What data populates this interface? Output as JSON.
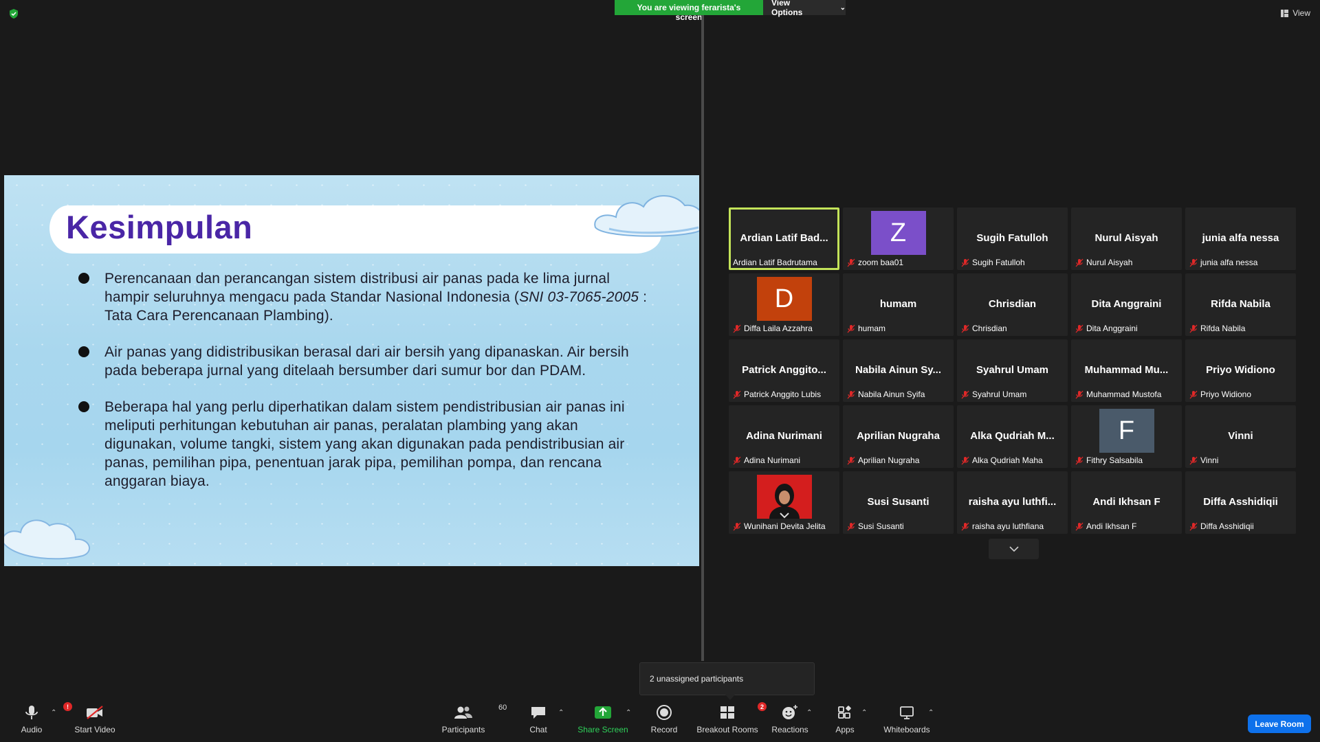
{
  "banner": {
    "viewing_text": "You are viewing ferarista's screen",
    "view_options_label": "View Options",
    "view_label": "View"
  },
  "slide": {
    "title": "Kesimpulan",
    "bullets": [
      {
        "pre": "Perencanaan dan perancangan sistem distribusi air panas pada ke lima jurnal hampir seluruhnya mengacu pada Standar Nasional Indonesia (",
        "italic": "SNI 03-7065-2005",
        "post": " : Tata Cara Perencanaan Plambing)."
      },
      {
        "pre": "Air panas yang didistribusikan berasal dari air bersih yang dipanaskan. Air bersih pada beberapa jurnal yang ditelaah bersumber dari sumur bor dan PDAM.",
        "italic": "",
        "post": ""
      },
      {
        "pre": "Beberapa hal yang perlu diperhatikan dalam sistem pendistribusian air panas ini meliputi perhitungan kebutuhan air panas, peralatan plambing yang akan digunakan, volume tangki, sistem yang akan digunakan pada pendistribusian air panas, pemilihan pipa, penentuan jarak pipa, pemilihan pompa, dan rencana anggaran biaya.",
        "italic": "",
        "post": ""
      }
    ]
  },
  "participants": [
    {
      "big": "Ardian Latif Bad...",
      "name": "Ardian Latif Badrutama",
      "muted": false,
      "active": true
    },
    {
      "avatar_letter": "Z",
      "avatar_color": "#7b4fc9",
      "name": "zoom baa01",
      "muted": true
    },
    {
      "big": "Sugih Fatulloh",
      "name": "Sugih Fatulloh",
      "muted": true
    },
    {
      "big": "Nurul Aisyah",
      "name": "Nurul Aisyah",
      "muted": true
    },
    {
      "big": "junia alfa nessa",
      "name": "junia alfa nessa",
      "muted": true
    },
    {
      "avatar_letter": "D",
      "avatar_color": "#c2410c",
      "name": "Diffa Laila Azzahra",
      "muted": true
    },
    {
      "big": "humam",
      "name": "humam",
      "muted": true
    },
    {
      "big": "Chrisdian",
      "name": "Chrisdian",
      "muted": true
    },
    {
      "big": "Dita Anggraini",
      "name": "Dita Anggraini",
      "muted": true
    },
    {
      "big": "Rifda Nabila",
      "name": "Rifda Nabila",
      "muted": true
    },
    {
      "big": "Patrick Anggito...",
      "name": "Patrick Anggito Lubis",
      "muted": true
    },
    {
      "big": "Nabila Ainun Sy...",
      "name": "Nabila Ainun Syifa",
      "muted": true
    },
    {
      "big": "Syahrul Umam",
      "name": "Syahrul Umam",
      "muted": true
    },
    {
      "big": "Muhammad Mu...",
      "name": "Muhammad Mustofa",
      "muted": true
    },
    {
      "big": "Priyo Widiono",
      "name": "Priyo Widiono",
      "muted": true
    },
    {
      "big": "Adina Nurimani",
      "name": "Adina Nurimani",
      "muted": true
    },
    {
      "big": "Aprilian Nugraha",
      "name": "Aprilian Nugraha",
      "muted": true
    },
    {
      "big": "Alka Qudriah M...",
      "name": "Alka Qudriah Maha",
      "muted": true
    },
    {
      "avatar_letter": "F",
      "avatar_color": "#4a5a6a",
      "name": "Fithry Salsabila",
      "muted": true
    },
    {
      "big": "Vinni",
      "name": "Vinni",
      "muted": true
    },
    {
      "photo": true,
      "name": "Wunihani Devita Jelita",
      "muted": true
    },
    {
      "big": "Susi Susanti",
      "name": "Susi Susanti",
      "muted": true
    },
    {
      "big": "raisha ayu luthfi...",
      "name": "raisha ayu luthfiana",
      "muted": true
    },
    {
      "big": "Andi Ikhsan F",
      "name": "Andi Ikhsan F",
      "muted": true
    },
    {
      "big": "Diffa Asshidiqii",
      "name": "Diffa Asshidiqii",
      "muted": true
    }
  ],
  "popup": {
    "unassigned_text": "2 unassigned participants"
  },
  "toolbar": {
    "audio_label": "Audio",
    "audio_badge": "!",
    "video_label": "Start Video",
    "participants_label": "Participants",
    "participants_count": "60",
    "chat_label": "Chat",
    "share_label": "Share Screen",
    "record_label": "Record",
    "breakout_label": "Breakout Rooms",
    "breakout_badge": "2",
    "reactions_label": "Reactions",
    "apps_label": "Apps",
    "whiteboards_label": "Whiteboards",
    "leave_label": "Leave Room"
  },
  "colors": {
    "accent_green": "#23a638",
    "leave_blue": "#0e71eb",
    "title_purple": "#4a26a6",
    "active_border": "#c3e359"
  }
}
